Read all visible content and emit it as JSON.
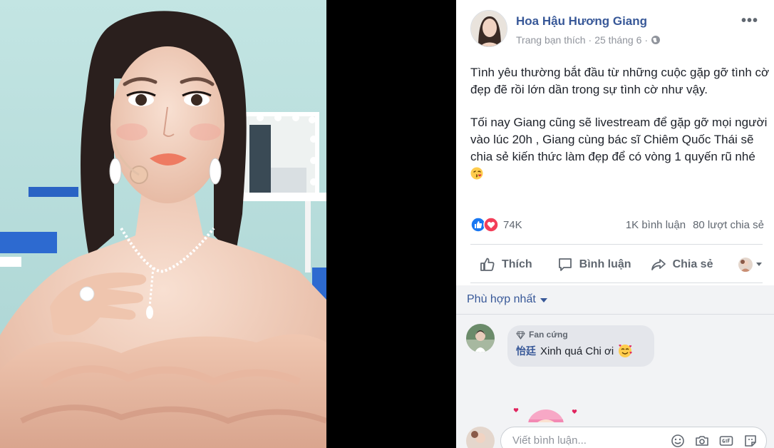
{
  "post": {
    "author": "Hoa Hậu Hương Giang",
    "meta_page": "Trang bạn thích",
    "meta_separator": "·",
    "meta_date": "25 tháng 6",
    "meta_separator2": "·",
    "more": "•••",
    "paragraph_1": "Tình yêu thường bắt đầu từ những cuộc gặp gỡ tình cờ đẹp đẽ rồi lớn dần trong sự tình cờ như vậy.",
    "paragraph_2": "Tối nay Giang cũng sẽ livestream để gặp gỡ mọi người vào lúc 20h , Giang cùng bác sĩ Chiêm Quốc Thái sẽ chia sẻ kiến thức làm đẹp để có vòng 1 quyến rũ nhé"
  },
  "reactions": {
    "count": "74K",
    "comments": "1K bình luận",
    "shares": "80 lượt chia sẻ"
  },
  "actions": {
    "like": "Thích",
    "comment": "Bình luận",
    "share": "Chia sẻ"
  },
  "comments_section": {
    "sort_label": "Phù hợp nhất",
    "items": [
      {
        "badge": "Fan cứng",
        "name": "怡廷",
        "text": "Xinh quá Chi ơi"
      }
    ]
  },
  "composer": {
    "placeholder": "Viết bình luận..."
  },
  "colors": {
    "link_blue": "#385898",
    "like_blue": "#1877f2",
    "love_red": "#f33e58",
    "panel_bg": "#ffffff",
    "comments_bg": "#f2f3f5"
  },
  "icons": [
    "globe-icon",
    "like-icon",
    "love-icon",
    "thumbs-up-icon",
    "comment-icon",
    "share-icon",
    "chevron-down-icon",
    "diamond-icon",
    "smile-icon",
    "camera-icon",
    "gif-icon",
    "sticker-icon"
  ]
}
